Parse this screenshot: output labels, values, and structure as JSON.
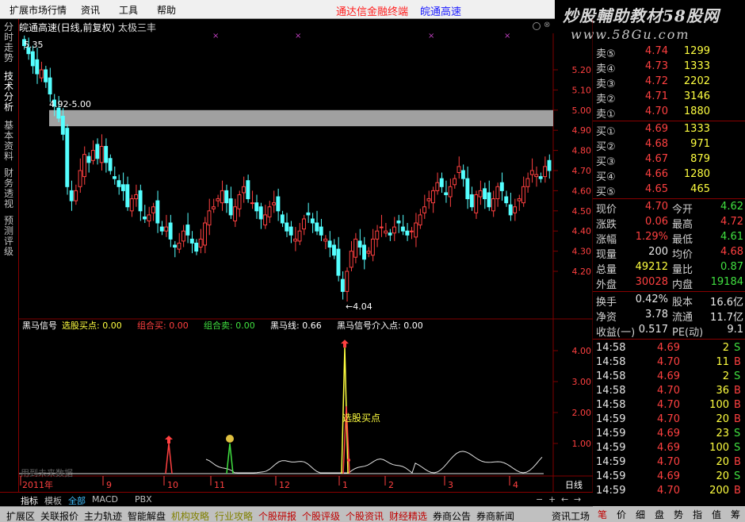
{
  "menu": {
    "items": [
      "扩展市场行情",
      "资讯",
      "工具",
      "帮助"
    ],
    "brand_left": "通达信金融终端",
    "brand_right": "皖通高速"
  },
  "watermark": {
    "line1": "炒股輔助教材58股网",
    "line2": "www.58Gu.com"
  },
  "vtabs": [
    "分时走势",
    "技术分析",
    "基本资料",
    "财务透视",
    "预测评级"
  ],
  "chart": {
    "title": "皖通高速(日线,前复权)",
    "subtitle": "太极三丰",
    "price_labels": [
      "5.20",
      "5.10",
      "5.00",
      "4.90",
      "4.80",
      "4.70",
      "4.60",
      "4.50",
      "4.40",
      "4.30",
      "4.20"
    ],
    "annot_high": "5.35",
    "annot_band": "4.92-5.00",
    "annot_low": "←4.04",
    "band_upper": 5.0,
    "band_lower": 4.92,
    "price_max": 5.35,
    "price_min": 4.04
  },
  "indicator": {
    "header": {
      "name": "黑马信号",
      "items": [
        {
          "label": "选股买点:",
          "value": "0.00",
          "color": "#ffff40"
        },
        {
          "label": "组合买:",
          "value": "0.00",
          "color": "#ff4040"
        },
        {
          "label": "组合卖:",
          "value": "0.00",
          "color": "#40e040"
        },
        {
          "label": "黑马线:",
          "value": "0.66",
          "color": "#ffffff"
        },
        {
          "label": "黑马信号介入点:",
          "value": "0.00",
          "color": "#ffffff"
        }
      ]
    },
    "axis_labels": [
      "4.00",
      "3.00",
      "2.00",
      "1.00"
    ],
    "annot_buy": "选股买点",
    "footer_note": "用到未来数据"
  },
  "time_axis": {
    "labels": [
      "2011年",
      "9",
      "10",
      "11",
      "12",
      "1",
      "2",
      "3",
      "4"
    ],
    "period": "日线"
  },
  "quote": {
    "asks": [
      {
        "label": "卖⑤",
        "price": "4.74",
        "vol": "1299"
      },
      {
        "label": "卖④",
        "price": "4.73",
        "vol": "1333"
      },
      {
        "label": "卖③",
        "price": "4.72",
        "vol": "2202"
      },
      {
        "label": "卖②",
        "price": "4.71",
        "vol": "3146"
      },
      {
        "label": "卖①",
        "price": "4.70",
        "vol": "1880"
      }
    ],
    "bids": [
      {
        "label": "买①",
        "price": "4.69",
        "vol": "1333"
      },
      {
        "label": "买②",
        "price": "4.68",
        "vol": "971"
      },
      {
        "label": "买③",
        "price": "4.67",
        "vol": "879"
      },
      {
        "label": "买④",
        "price": "4.66",
        "vol": "1280"
      },
      {
        "label": "买⑤",
        "price": "4.65",
        "vol": "465"
      }
    ],
    "stats": [
      {
        "l1": "现价",
        "v1": "4.70",
        "c1": "red",
        "l2": "今开",
        "v2": "4.62",
        "c2": "green"
      },
      {
        "l1": "涨跌",
        "v1": "0.06",
        "c1": "red",
        "l2": "最高",
        "v2": "4.72",
        "c2": "red"
      },
      {
        "l1": "涨幅",
        "v1": "1.29%",
        "c1": "red",
        "l2": "最低",
        "v2": "4.61",
        "c2": "green"
      },
      {
        "l1": "现量",
        "v1": "200",
        "c1": "white",
        "l2": "均价",
        "v2": "4.68",
        "c2": "red"
      },
      {
        "l1": "总量",
        "v1": "49212",
        "c1": "yellow",
        "l2": "量比",
        "v2": "0.87",
        "c2": "green"
      },
      {
        "l1": "外盘",
        "v1": "30028",
        "c1": "red",
        "l2": "内盘",
        "v2": "19184",
        "c2": "green"
      }
    ],
    "fund": [
      {
        "l1": "换手",
        "v1": "0.42%",
        "l2": "股本",
        "v2": "16.6亿"
      },
      {
        "l1": "净资",
        "v1": "3.78",
        "l2": "流通",
        "v2": "11.7亿"
      },
      {
        "l1": "收益(一)",
        "v1": "0.517",
        "l2": "PE(动)",
        "v2": "9.1"
      }
    ],
    "ticks": [
      {
        "t": "14:58",
        "p": "4.69",
        "pc": "red",
        "v": "2",
        "s": "S"
      },
      {
        "t": "14:58",
        "p": "4.70",
        "pc": "red",
        "v": "11",
        "s": "B"
      },
      {
        "t": "14:58",
        "p": "4.69",
        "pc": "red",
        "v": "2",
        "s": "S"
      },
      {
        "t": "14:58",
        "p": "4.70",
        "pc": "red",
        "v": "36",
        "s": "B"
      },
      {
        "t": "14:58",
        "p": "4.70",
        "pc": "red",
        "v": "100",
        "s": "B"
      },
      {
        "t": "14:59",
        "p": "4.70",
        "pc": "red",
        "v": "20",
        "s": "B"
      },
      {
        "t": "14:59",
        "p": "4.69",
        "pc": "red",
        "v": "23",
        "s": "S"
      },
      {
        "t": "14:59",
        "p": "4.69",
        "pc": "red",
        "v": "100",
        "s": "S"
      },
      {
        "t": "14:59",
        "p": "4.70",
        "pc": "red",
        "v": "20",
        "s": "B"
      },
      {
        "t": "14:59",
        "p": "4.69",
        "pc": "red",
        "v": "20",
        "s": "S"
      },
      {
        "t": "14:59",
        "p": "4.70",
        "pc": "red",
        "v": "200",
        "s": "B"
      }
    ]
  },
  "bottom_tabs1": [
    {
      "label": "指标",
      "color": "#ffffff"
    },
    {
      "label": "模板",
      "color": "#c0c0c0"
    },
    {
      "label": "全部",
      "color": "#40c0ff"
    },
    {
      "label": "MACD",
      "color": "#c0c0c0"
    },
    {
      "label": "PBX",
      "color": "#c0c0c0"
    }
  ],
  "bottom_tabs2": [
    {
      "label": "扩展区",
      "color": "#000000"
    },
    {
      "label": "关联报价",
      "color": "#000000"
    },
    {
      "label": "主力轨迹",
      "color": "#000000"
    },
    {
      "label": "智能解盘",
      "color": "#000000"
    },
    {
      "label": "机构攻略",
      "color": "#808000"
    },
    {
      "label": "行业攻略",
      "color": "#808000"
    },
    {
      "label": "个股研报",
      "color": "#c00000"
    },
    {
      "label": "个股评级",
      "color": "#c00000"
    },
    {
      "label": "个股资讯",
      "color": "#c00000"
    },
    {
      "label": "财经精选",
      "color": "#c00000"
    },
    {
      "label": "券商公告",
      "color": "#000000"
    },
    {
      "label": "券商新闻",
      "color": "#000000"
    },
    {
      "label": "资讯工场",
      "color": "#000000"
    }
  ],
  "right_tabs": [
    "笔",
    "价",
    "细",
    "盘",
    "势",
    "指",
    "值",
    "筹"
  ],
  "colors": {
    "up": "#ff4040",
    "down": "#54ffff",
    "band": "#a0a0a0",
    "grid": "#800000"
  }
}
